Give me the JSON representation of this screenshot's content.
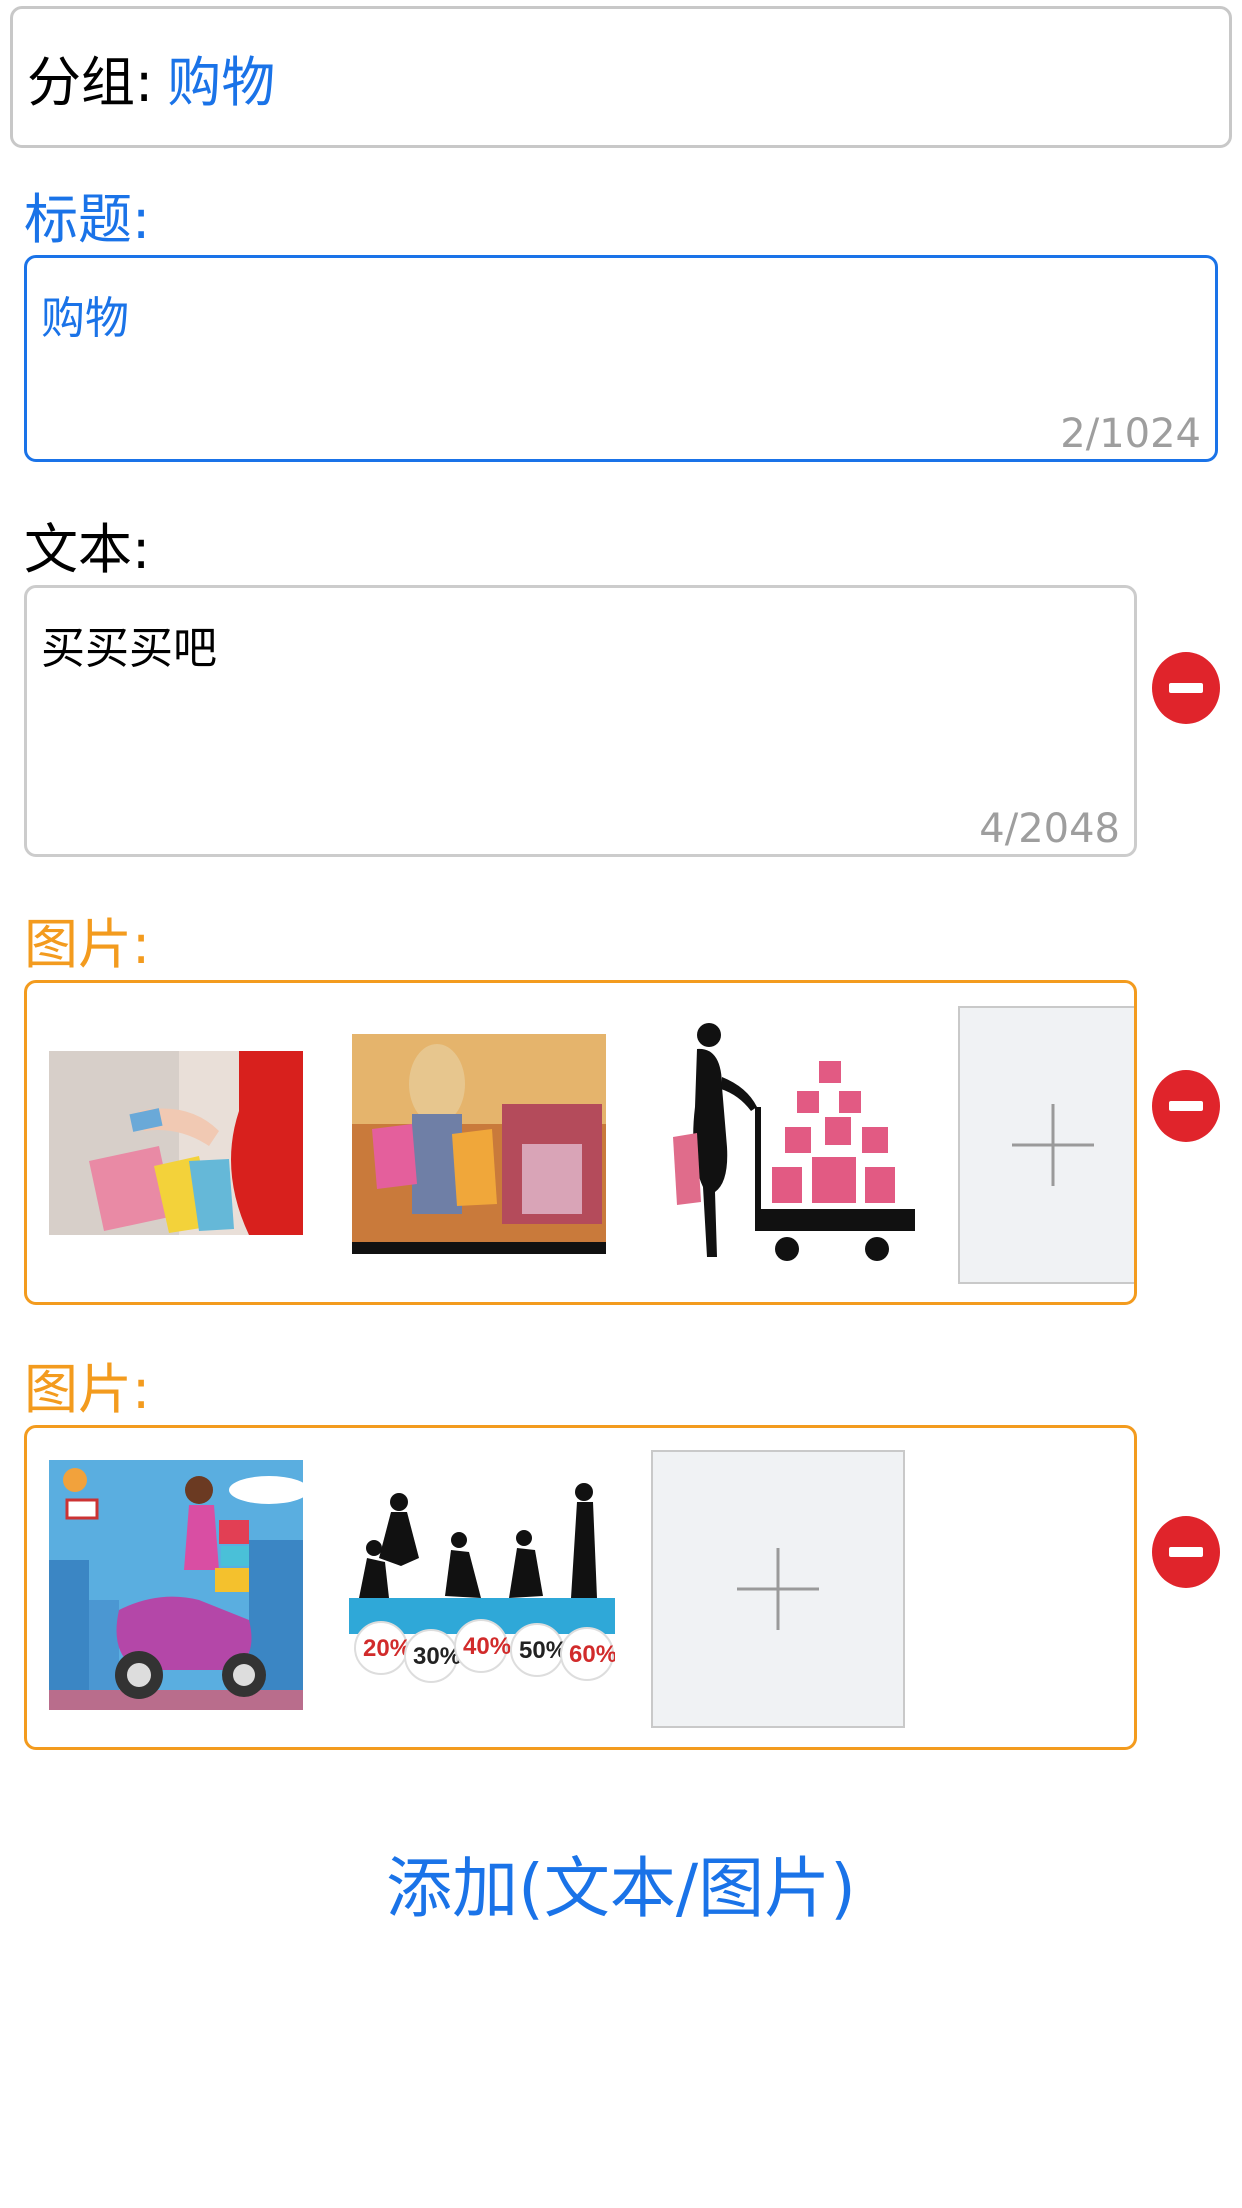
{
  "group": {
    "label": "分组:",
    "value": "购物"
  },
  "title_section": {
    "label": "标题:",
    "value": "购物",
    "counter": "2/1024"
  },
  "text_section": {
    "label": "文本:",
    "value": "买买买吧",
    "counter": "4/2048"
  },
  "image_sections": [
    {
      "label": "图片:",
      "images": [
        "shopping-hand-bags",
        "woman-shopping-mall",
        "woman-cart-gifts"
      ]
    },
    {
      "label": "图片:",
      "images": [
        "scooter-girl-gifts",
        "sale-silhouettes"
      ],
      "sale_tags": [
        "20%",
        "30%",
        "40%",
        "50%",
        "60%"
      ]
    }
  ],
  "add_button": {
    "label": "添加(文本/图片)"
  },
  "icons": {
    "remove": "minus-circle-icon",
    "add": "plus-icon"
  },
  "colors": {
    "accent": "#1a73e8",
    "image_border": "#f39b1e",
    "remove": "#e0242b"
  }
}
